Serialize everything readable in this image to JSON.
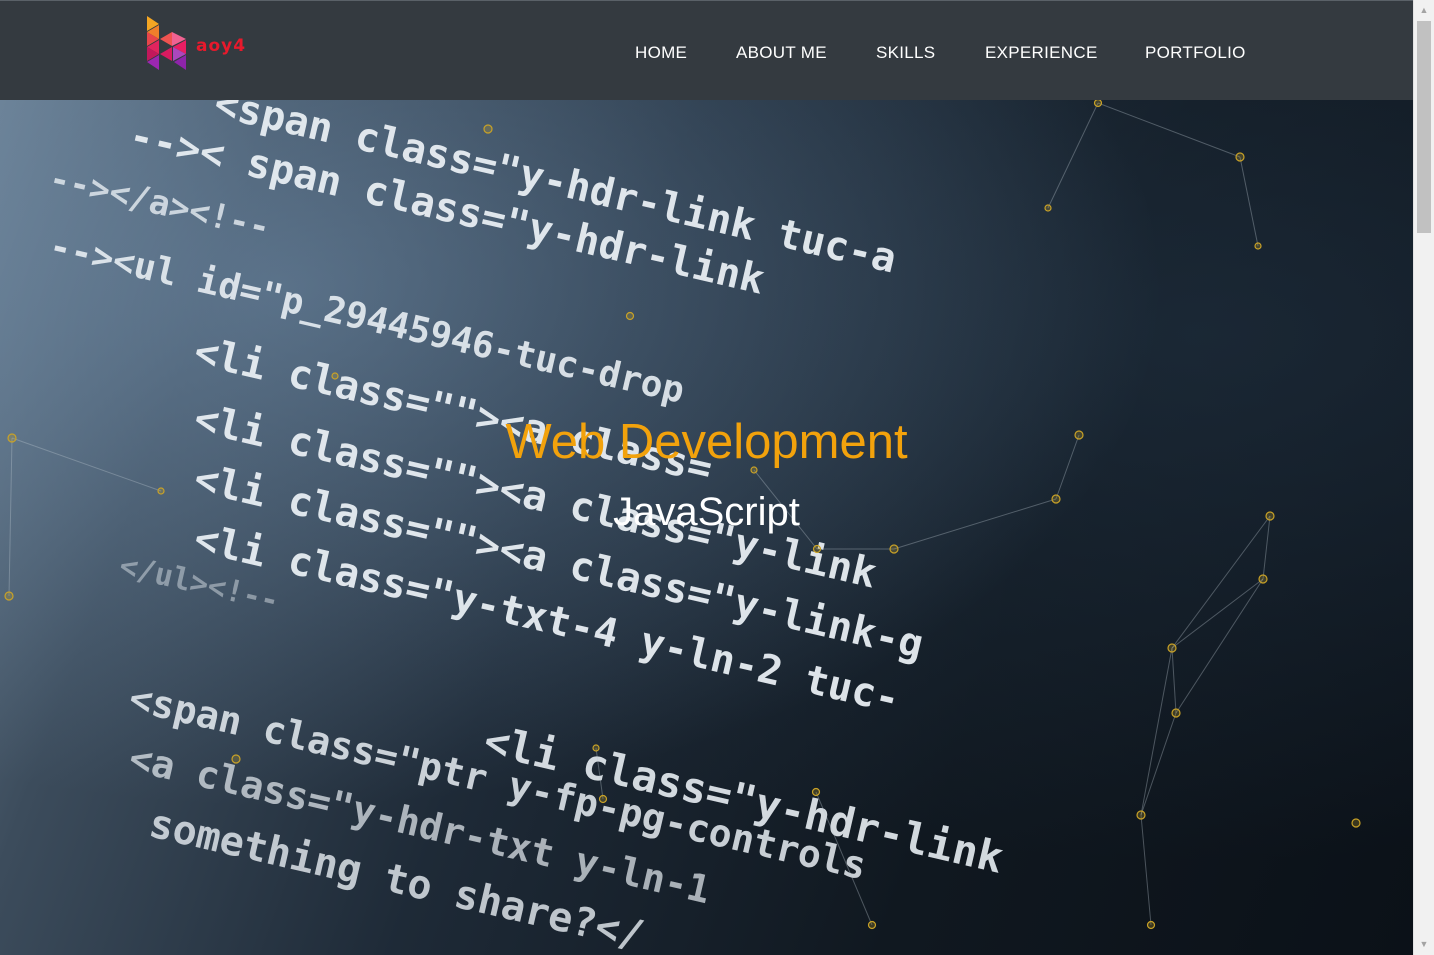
{
  "brand": {
    "logo_text": "aoy4"
  },
  "nav": [
    {
      "label": "HOME"
    },
    {
      "label": "ABOUT ME"
    },
    {
      "label": "SKILLS"
    },
    {
      "label": "EXPERIENCE"
    },
    {
      "label": "PORTFOLIO"
    }
  ],
  "hero": {
    "title": "Web Development",
    "subtitle": "JavaScript",
    "background_code_lines": [
      "<span class=\"y-hdr-link tuc-a",
      "-->< span class=\"y-hdr-link",
      "--></a><!--",
      "--><ul id=\"p_29445946-tuc-drop",
      "<li class=\"\"><a class=",
      "<li class=\"\"><a class=\"y-link",
      "<li class=\"\"><a class=\"y-link-g",
      "<li class=\"y-txt-4 y-ln-2 tuc-",
      "</ul><!--",
      "<span class=\"ptr y-fp-pg-controls",
      "<a class=\"y-hdr-txt y-ln-1",
      "something to share?</",
      "<li class=\"y-hdr-link"
    ]
  },
  "colors": {
    "navbar": "#343a40",
    "accent": "#f2a20c",
    "nav_text": "#ffffff",
    "particle": "#c9a227"
  }
}
